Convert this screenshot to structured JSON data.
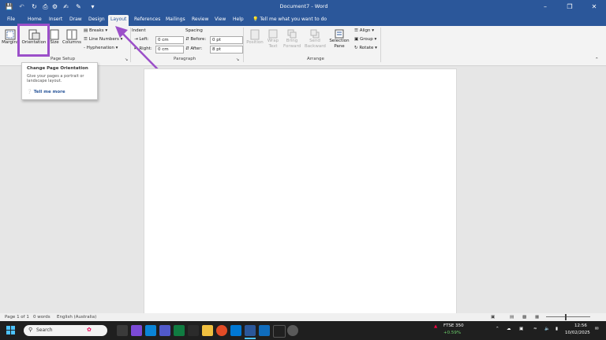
{
  "app": {
    "title": "Document7 - Word"
  },
  "tabs": [
    "File",
    "Home",
    "Insert",
    "Draw",
    "Design",
    "Layout",
    "References",
    "Mailings",
    "Review",
    "View",
    "Help"
  ],
  "active_tab": "Layout",
  "tell_me": "Tell me what you want to do",
  "ribbon": {
    "margins": "Margins",
    "orientation": "Orientation",
    "size": "Size",
    "columns": "Columns",
    "breaks": "Breaks",
    "line_numbers": "Line Numbers",
    "hyphenation": "Hyphenation",
    "page_setup_label": "Page Setup",
    "indent_label": "Indent",
    "indent_left_label": "Left:",
    "indent_left_value": "0 cm",
    "indent_right_label": "Right:",
    "indent_right_value": "0 cm",
    "spacing_label": "Spacing",
    "before_label": "Before:",
    "before_value": "0 pt",
    "after_label": "After:",
    "after_value": "8 pt",
    "paragraph_label": "Paragraph",
    "position": "Position",
    "wrap": "Wrap",
    "wrap2": "Text",
    "bring": "Bring",
    "bring2": "Forward",
    "send": "Send",
    "send2": "Backward",
    "selection": "Selection",
    "selection2": "Pane",
    "align": "Align",
    "group": "Group",
    "rotate": "Rotate",
    "arrange_label": "Arrange"
  },
  "tooltip": {
    "title": "Change Page Orientation",
    "description": "Give your pages a portrait or landscape layout.",
    "link": "Tell me more"
  },
  "status": {
    "page": "Page 1 of 1",
    "words": "0 words",
    "language": "English (Australia)"
  },
  "taskbar": {
    "search": "Search",
    "stock_name": "FTSE 350",
    "stock_change": "+0.59%",
    "time": "12:56",
    "date": "10/02/2025"
  },
  "colors": {
    "word_blue": "#2b579a",
    "highlight": "#9b4fc9"
  }
}
